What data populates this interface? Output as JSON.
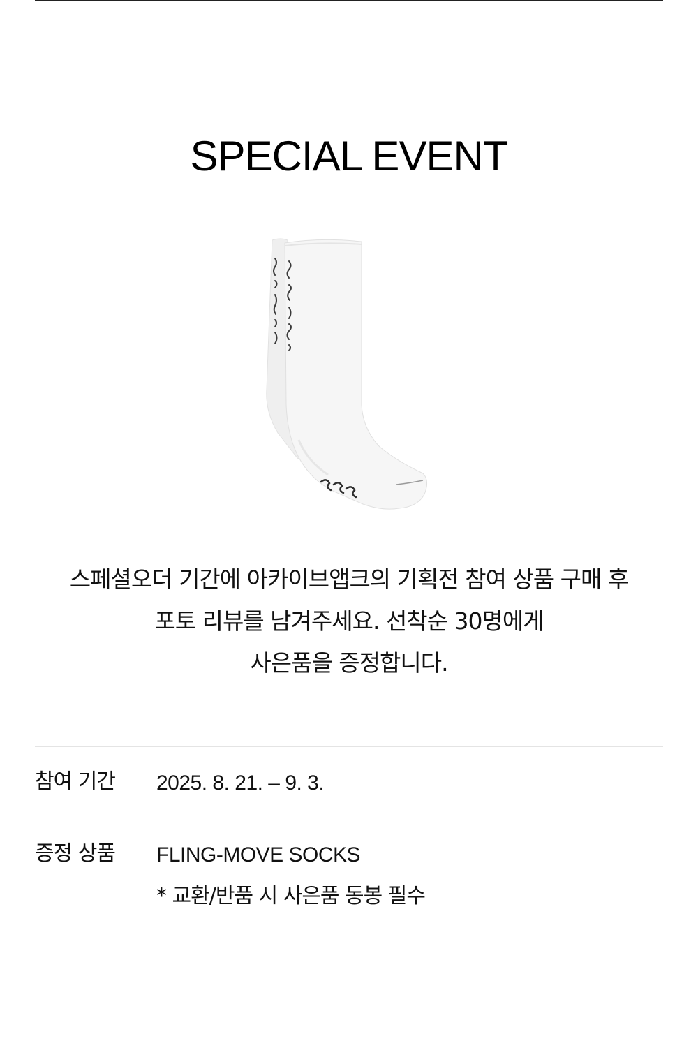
{
  "title": "SPECIAL EVENT",
  "product_image": {
    "alt": "FLING-MOVE SOCKS",
    "sock_color": "#f4f4f4",
    "print_color": "#3a3a3a"
  },
  "description": {
    "lines": [
      "스페셜오더 기간에 아카이브앱크의 기획전 참여 상품 구매 후",
      "포토 리뷰를 남겨주세요. 선착순 30명에게",
      "사은품을 증정합니다."
    ]
  },
  "info": {
    "period": {
      "label": "참여 기간",
      "value": "2025. 8. 21. – 9. 3."
    },
    "gift": {
      "label": "증정 상품",
      "value": "FLING-MOVE SOCKS",
      "note": "* 교환/반품 시 사은품 동봉 필수"
    }
  },
  "colors": {
    "text": "#111111",
    "divider": "#e4e4e4",
    "top_rule": "#222222"
  }
}
